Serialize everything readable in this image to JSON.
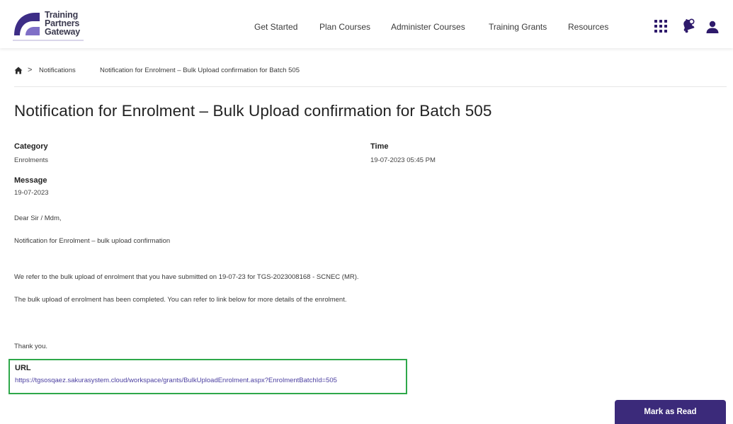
{
  "header": {
    "logo_lines": [
      "Training",
      "Partners",
      "Gateway"
    ],
    "nav": [
      {
        "label": "Get Started"
      },
      {
        "label": "Plan Courses"
      },
      {
        "label": "Administer Courses"
      },
      {
        "label": "Training Grants"
      },
      {
        "label": "Resources"
      }
    ],
    "icons": [
      "apps-grid-icon",
      "notification-bell-icon",
      "user-icon"
    ]
  },
  "breadcrumb": {
    "home_icon": "home-icon",
    "separator": ">",
    "items": [
      "Notifications",
      "Notification for Enrolment – Bulk Upload confirmation for Batch 505"
    ]
  },
  "notification": {
    "title": "Notification for Enrolment – Bulk Upload confirmation for Batch 505",
    "category_label": "Category",
    "category_value": "Enrolments",
    "time_label": "Time",
    "time_value": "19-07-2023 05:45 PM",
    "message_label": "Message",
    "message_date": "19-07-2023",
    "message_lines": [
      "Dear Sir / Mdm,",
      "Notification for Enrolment – bulk upload confirmation",
      "We refer to the bulk upload of enrolment that you have submitted on 19-07-23 for TGS-2023008168 - SCNEC (MR).",
      "The bulk upload of enrolment has been completed. You can refer to link below for more details of the enrolment.",
      "Thank you."
    ],
    "url_label": "URL",
    "url_value": "https://tgsosqaez.sakurasystem.cloud/workspace/grants/BulkUploadEnrolment.aspx?EnrolmentBatchId=505"
  },
  "actions": {
    "mark_read_label": "Mark as Read"
  },
  "colors": {
    "brand_purple": "#3b2a7a",
    "highlight_green": "#2ea84a",
    "link": "#4b3fa0"
  }
}
